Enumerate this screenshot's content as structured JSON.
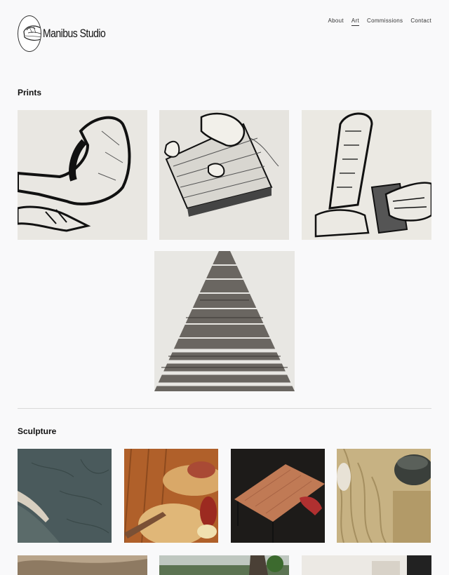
{
  "header": {
    "logo_text": "Manibus Studio",
    "nav": [
      {
        "label": "About",
        "active": false
      },
      {
        "label": "Art",
        "active": true
      },
      {
        "label": "Commissions",
        "active": false
      },
      {
        "label": "Contact",
        "active": false
      }
    ]
  },
  "sections": {
    "prints": {
      "title": "Prints"
    },
    "sculpture": {
      "title": "Sculpture"
    }
  },
  "colors": {
    "page_background": "#f9f9fa",
    "divider": "#d9d9d9",
    "text": "#111111"
  }
}
